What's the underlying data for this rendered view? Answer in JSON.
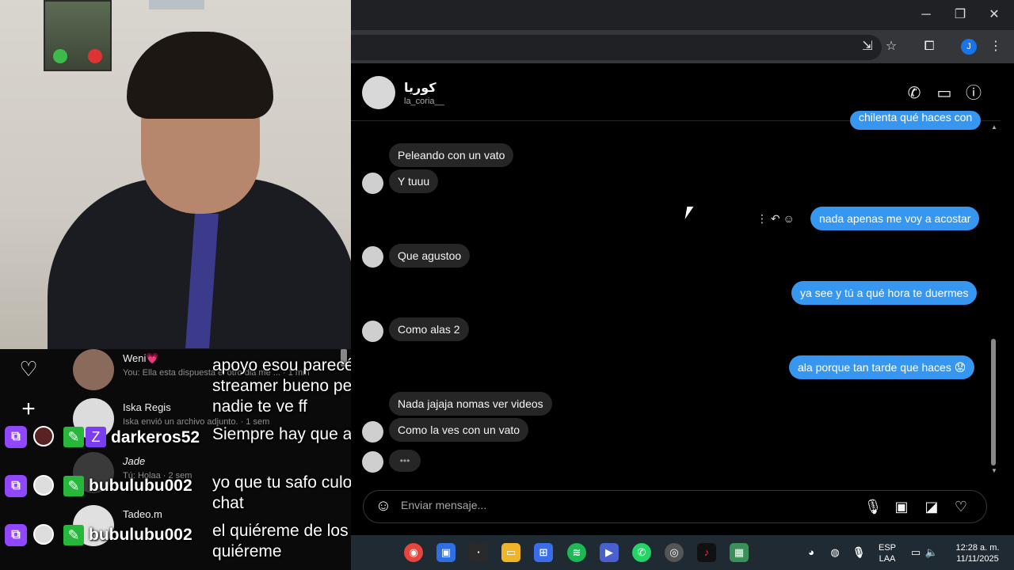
{
  "browser": {
    "window_buttons": {
      "minimize": "─",
      "maximize": "❐",
      "close": "✕"
    },
    "profile_initial": "J"
  },
  "conversation": {
    "name": "كوريا",
    "username": "la_coria__",
    "cut_off_message": "chilenta qué haces con",
    "messages": [
      {
        "dir": "in",
        "text": "Peleando con un vato"
      },
      {
        "dir": "in",
        "text": "Y tuuu"
      },
      {
        "dir": "out",
        "text": "nada apenas me voy a acostar"
      },
      {
        "dir": "in",
        "text": "Que agustoo"
      },
      {
        "dir": "out",
        "text": "ya see y tú a qué hora te duermes"
      },
      {
        "dir": "in",
        "text": "Como alas 2"
      },
      {
        "dir": "out",
        "text": "ala porque tan tarde que haces 😟"
      },
      {
        "dir": "in",
        "text": "Nada jajaja nomas ver videos"
      },
      {
        "dir": "in",
        "text": "Como la ves con un vato"
      }
    ],
    "typing": "•••",
    "composer_placeholder": "Enviar mensaje..."
  },
  "ig_list": [
    {
      "name": "Weni💗",
      "sub": "You: Ella esta dispuesta el otro dia me ... · 1 min"
    },
    {
      "name": "Iska Regis",
      "sub": "Iska envió un archivo adjunto. · 1 sem"
    },
    {
      "name": "Jade",
      "sub": "Tú: Holaa · 2 sem"
    },
    {
      "name": "Tadeo.m",
      "sub": ""
    }
  ],
  "stream_chat": [
    {
      "user": "",
      "text": "apoyo esou parecés streamer bueno pero nadie te ve ff"
    },
    {
      "user": "darkeros52",
      "text": "Siempre hay que arriesgar"
    },
    {
      "user": "bubulubu002",
      "text": "yo que tu safo culo de ese chat"
    },
    {
      "user": "bubulubu002",
      "text": "el quiéreme de los quiéreme"
    }
  ],
  "taskbar": {
    "lang_top": "ESP",
    "lang_bottom": "LAA",
    "time": "12:28 a. m.",
    "date": "11/11/2025"
  },
  "colors": {
    "outgoing": "#3797f0",
    "incoming": "#262626",
    "twitch": "#9146ff"
  }
}
